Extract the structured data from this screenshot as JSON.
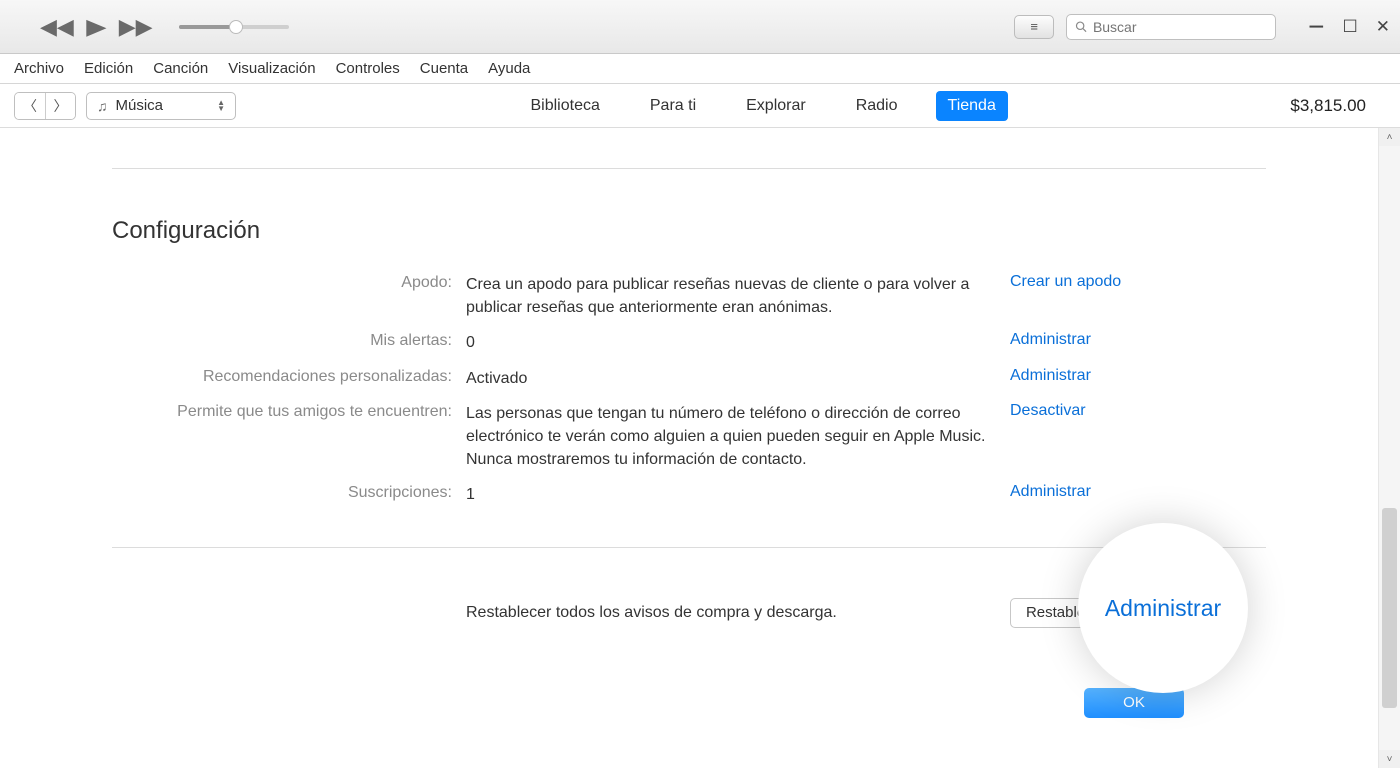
{
  "search": {
    "placeholder": "Buscar"
  },
  "menu": {
    "archivo": "Archivo",
    "edicion": "Edición",
    "cancion": "Canción",
    "visualizacion": "Visualización",
    "controles": "Controles",
    "cuenta": "Cuenta",
    "ayuda": "Ayuda"
  },
  "nav": {
    "library_label": "Música",
    "tabs": {
      "biblioteca": "Biblioteca",
      "para_ti": "Para ti",
      "explorar": "Explorar",
      "radio": "Radio",
      "tienda": "Tienda"
    },
    "balance": "$3,815.00"
  },
  "section_title": "Configuración",
  "settings": {
    "apodo": {
      "label": "Apodo:",
      "value": "Crea un apodo para publicar reseñas nuevas de cliente o para volver a publicar reseñas que anteriormente eran anónimas.",
      "action": "Crear un apodo"
    },
    "alertas": {
      "label": "Mis alertas:",
      "value": "0",
      "action": "Administrar"
    },
    "recom": {
      "label": "Recomendaciones personalizadas:",
      "value": "Activado",
      "action": "Administrar"
    },
    "amigos": {
      "label": "Permite que tus amigos te encuentren:",
      "value": "Las personas que tengan tu número de teléfono o dirección de correo electrónico te verán como alguien a quien pueden seguir en Apple Music. Nunca mostraremos tu información de contacto.",
      "action": "Desactivar"
    },
    "subs": {
      "label": "Suscripciones:",
      "value": "1",
      "action": "Administrar"
    }
  },
  "reset": {
    "text": "Restablecer todos los avisos de compra y descarga.",
    "button": "Restablecer"
  },
  "ok": "OK",
  "bubble": "Administrar"
}
